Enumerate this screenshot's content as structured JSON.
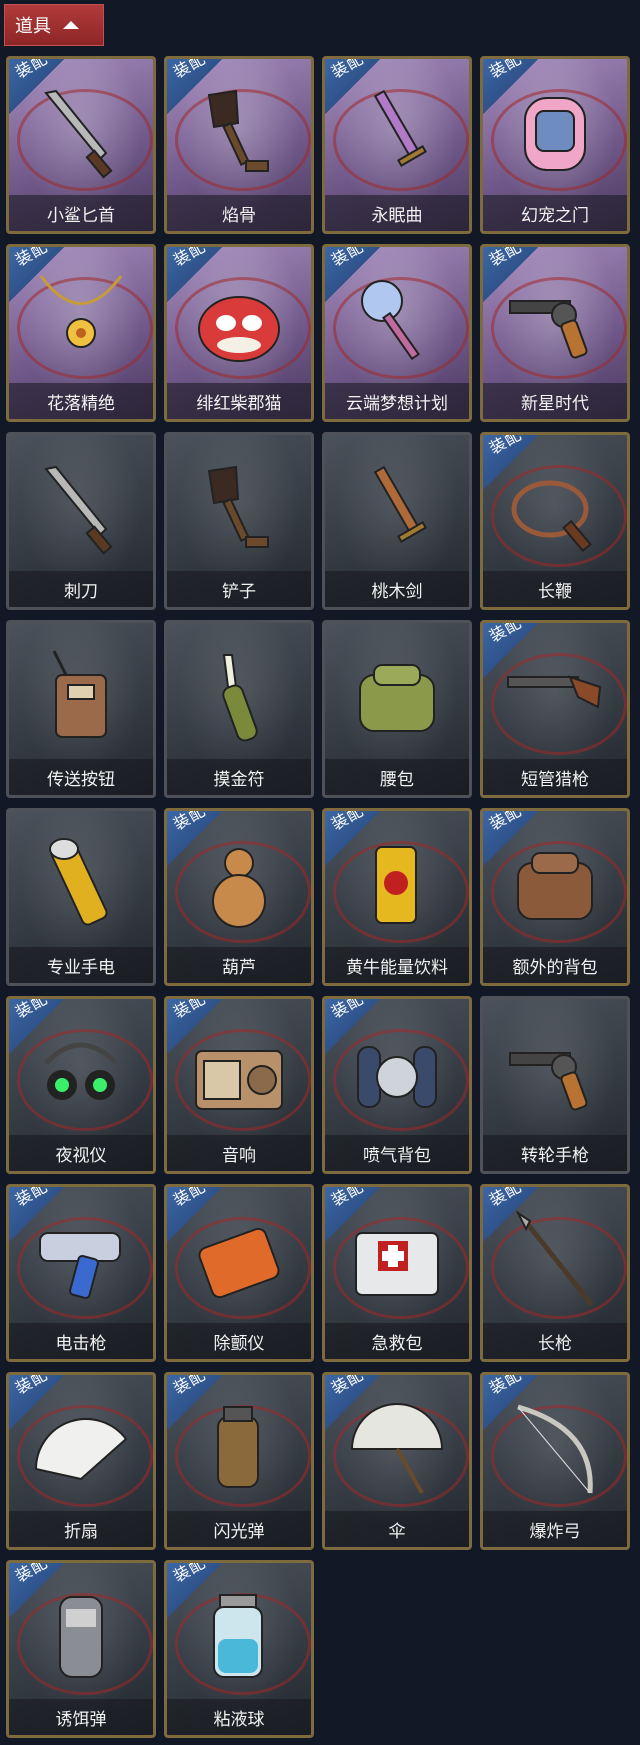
{
  "header": {
    "title": "道具"
  },
  "badge_text": "装配",
  "items": [
    {
      "name": "小鲨匕首",
      "style": "purple",
      "equip": true,
      "icon": "shark-dagger-icon"
    },
    {
      "name": "焰骨",
      "style": "purple",
      "equip": true,
      "icon": "flame-bone-icon"
    },
    {
      "name": "永眠曲",
      "style": "purple",
      "equip": true,
      "icon": "sword-icon"
    },
    {
      "name": "幻宠之门",
      "style": "purple",
      "equip": true,
      "icon": "pet-device-icon"
    },
    {
      "name": "花落精绝",
      "style": "purple",
      "equip": true,
      "icon": "flower-necklace-icon"
    },
    {
      "name": "绯红柴郡猫",
      "style": "purple",
      "equip": true,
      "icon": "cheshire-cat-icon"
    },
    {
      "name": "云端梦想计划",
      "style": "purple",
      "equip": true,
      "icon": "magic-wand-icon"
    },
    {
      "name": "新星时代",
      "style": "purple",
      "equip": true,
      "icon": "revolver-icon"
    },
    {
      "name": "刺刀",
      "style": "gray",
      "equip": false,
      "icon": "knife-icon"
    },
    {
      "name": "铲子",
      "style": "gray",
      "equip": false,
      "icon": "shovel-icon"
    },
    {
      "name": "桃木剑",
      "style": "gray",
      "equip": false,
      "icon": "wood-sword-icon"
    },
    {
      "name": "长鞭",
      "style": "gray",
      "equip": true,
      "icon": "whip-icon"
    },
    {
      "name": "传送按钮",
      "style": "gray",
      "equip": false,
      "icon": "remote-icon"
    },
    {
      "name": "摸金符",
      "style": "gray",
      "equip": false,
      "icon": "talisman-icon"
    },
    {
      "name": "腰包",
      "style": "gray",
      "equip": false,
      "icon": "bag-icon"
    },
    {
      "name": "短管猎枪",
      "style": "gray",
      "equip": true,
      "icon": "shotgun-icon"
    },
    {
      "name": "专业手电",
      "style": "gray",
      "equip": false,
      "icon": "flashlight-icon"
    },
    {
      "name": "葫芦",
      "style": "gray",
      "equip": true,
      "icon": "gourd-icon"
    },
    {
      "name": "黄牛能量饮料",
      "style": "gray",
      "equip": true,
      "icon": "can-icon"
    },
    {
      "name": "额外的背包",
      "style": "gray",
      "equip": true,
      "icon": "backpack-icon"
    },
    {
      "name": "夜视仪",
      "style": "gray",
      "equip": true,
      "icon": "goggles-icon"
    },
    {
      "name": "音响",
      "style": "gray",
      "equip": true,
      "icon": "radio-icon"
    },
    {
      "name": "喷气背包",
      "style": "gray",
      "equip": true,
      "icon": "jetpack-icon"
    },
    {
      "name": "转轮手枪",
      "style": "gray",
      "equip": false,
      "icon": "revolver-icon"
    },
    {
      "name": "电击枪",
      "style": "gray",
      "equip": true,
      "icon": "taser-icon"
    },
    {
      "name": "除颤仪",
      "style": "gray",
      "equip": true,
      "icon": "defibrillator-icon"
    },
    {
      "name": "急救包",
      "style": "gray",
      "equip": true,
      "icon": "first-aid-icon"
    },
    {
      "name": "长枪",
      "style": "gray",
      "equip": true,
      "icon": "spear-icon"
    },
    {
      "name": "折扇",
      "style": "gray",
      "equip": true,
      "icon": "fan-icon"
    },
    {
      "name": "闪光弹",
      "style": "gray",
      "equip": true,
      "icon": "grenade-icon"
    },
    {
      "name": "伞",
      "style": "gray",
      "equip": true,
      "icon": "umbrella-icon"
    },
    {
      "name": "爆炸弓",
      "style": "gray",
      "equip": true,
      "icon": "bow-icon"
    },
    {
      "name": "诱饵弹",
      "style": "gray",
      "equip": true,
      "icon": "decoy-icon"
    },
    {
      "name": "粘液球",
      "style": "gray",
      "equip": true,
      "icon": "slime-bottle-icon"
    }
  ]
}
